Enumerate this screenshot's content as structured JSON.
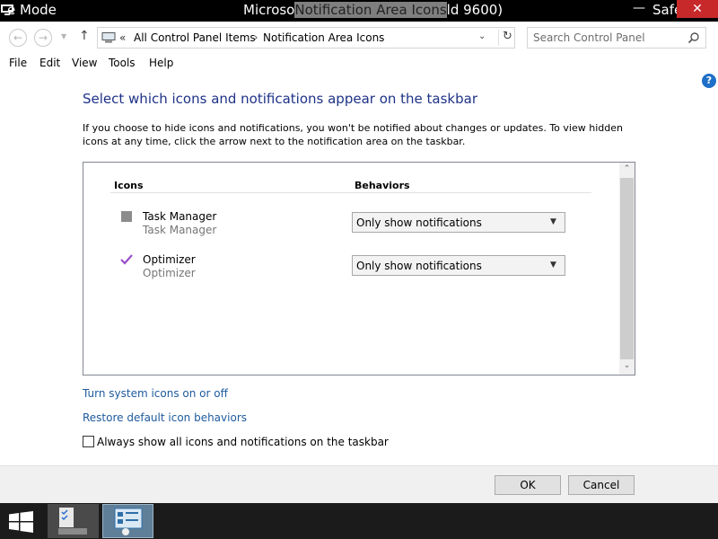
{
  "window": {
    "safe_mode_left": "e Mode",
    "title_prefix": "Microso",
    "title_highlight": "Notification Area Icons",
    "title_suffix": "ld 9600)",
    "safe_mode_right": "Safe",
    "close_glyph": "✕",
    "minimize_glyph": "—"
  },
  "navigation": {
    "back_glyph": "←",
    "forward_glyph": "→",
    "dropdown_glyph": "▼",
    "up_glyph": "↑",
    "address": {
      "chevron": "«",
      "breadcrumb": [
        "All Control Panel Items",
        "Notification Area Icons"
      ],
      "separator": "›",
      "dropdown_glyph": "⌄",
      "refresh_glyph": "↻"
    },
    "search_placeholder": "Search Control Panel"
  },
  "menu": {
    "items": [
      "File",
      "Edit",
      "View",
      "Tools",
      "Help"
    ]
  },
  "help_glyph": "?",
  "main": {
    "heading": "Select which icons and notifications appear on the taskbar",
    "description": "If you choose to hide icons and notifications, you won't be notified about changes or updates. To view hidden icons at any time, click the arrow next to the notification area on the taskbar.",
    "columns": {
      "icons": "Icons",
      "behaviors": "Behaviors"
    },
    "rows": [
      {
        "name": "Task Manager",
        "subtitle": "Task Manager",
        "behavior": "Only show notifications",
        "icon": "task-manager-icon"
      },
      {
        "name": "Optimizer",
        "subtitle": "Optimizer",
        "behavior": "Only show notifications",
        "icon": "checkmark-icon"
      }
    ],
    "scroll_up_glyph": "⌃",
    "scroll_down_glyph": "⌄",
    "links": {
      "system_icons": "Turn system icons on or off",
      "restore_defaults": "Restore default icon behaviors"
    },
    "checkbox": {
      "label": "Always show all icons and notifications on the taskbar",
      "checked": false
    }
  },
  "footer": {
    "ok": "OK",
    "cancel": "Cancel"
  },
  "colors": {
    "heading": "#1e3287",
    "link": "#1e5a9d",
    "close_button": "#c7292a",
    "checkmark": "#9b4fc8",
    "taskbar": "#1b1b1b"
  }
}
